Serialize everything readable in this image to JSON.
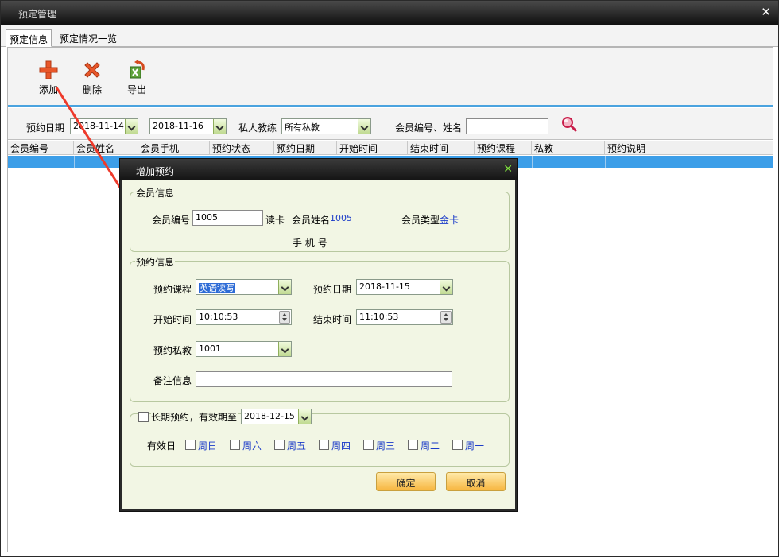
{
  "window": {
    "title": "预定管理"
  },
  "tabs": [
    {
      "label": "预定信息"
    },
    {
      "label": "预定情况一览"
    }
  ],
  "toolbar": {
    "add_label": "添加",
    "delete_label": "删除",
    "export_label": "导出"
  },
  "filters": {
    "date_label": "预约日期",
    "date_from": "2018-11-14",
    "date_to": "2018-11-16",
    "trainer_label": "私人教练",
    "trainer_value": "所有私教",
    "member_label": "会员编号、姓名",
    "member_value": ""
  },
  "grid": {
    "columns": [
      "会员编号",
      "会员姓名",
      "会员手机",
      "预约状态",
      "预约日期",
      "开始时间",
      "结束时间",
      "预约课程",
      "私教",
      "预约说明"
    ]
  },
  "dialog": {
    "title": "增加预约",
    "member_group": "会员信息",
    "member_no_label": "会员编号",
    "member_no_value": "1005",
    "read_card": "读卡",
    "member_name_label": "会员姓名",
    "member_name_value": "1005",
    "member_type_label": "会员类型",
    "member_type_value": "金卡",
    "phone_label": "手 机 号",
    "booking_group": "预约信息",
    "course_label": "预约课程",
    "course_value": "英语读写",
    "date_label": "预约日期",
    "date_value": "2018-11-15",
    "start_label": "开始时间",
    "start_value": "10:10:53",
    "end_label": "结束时间",
    "end_value": "11:10:53",
    "trainer_label": "预约私教",
    "trainer_value": "1001",
    "note_label": "备注信息",
    "note_value": "",
    "longterm_label": "长期预约，有效期至",
    "longterm_date": "2018-12-15",
    "valid_days_label": "有效日",
    "days": [
      "周日",
      "周六",
      "周五",
      "周四",
      "周三",
      "周二",
      "周一"
    ],
    "ok": "确定",
    "cancel": "取消"
  },
  "colors": {
    "accent": "#3c9ee8",
    "dialog_bg": "#f2f6e4",
    "button": "#f7b640"
  }
}
